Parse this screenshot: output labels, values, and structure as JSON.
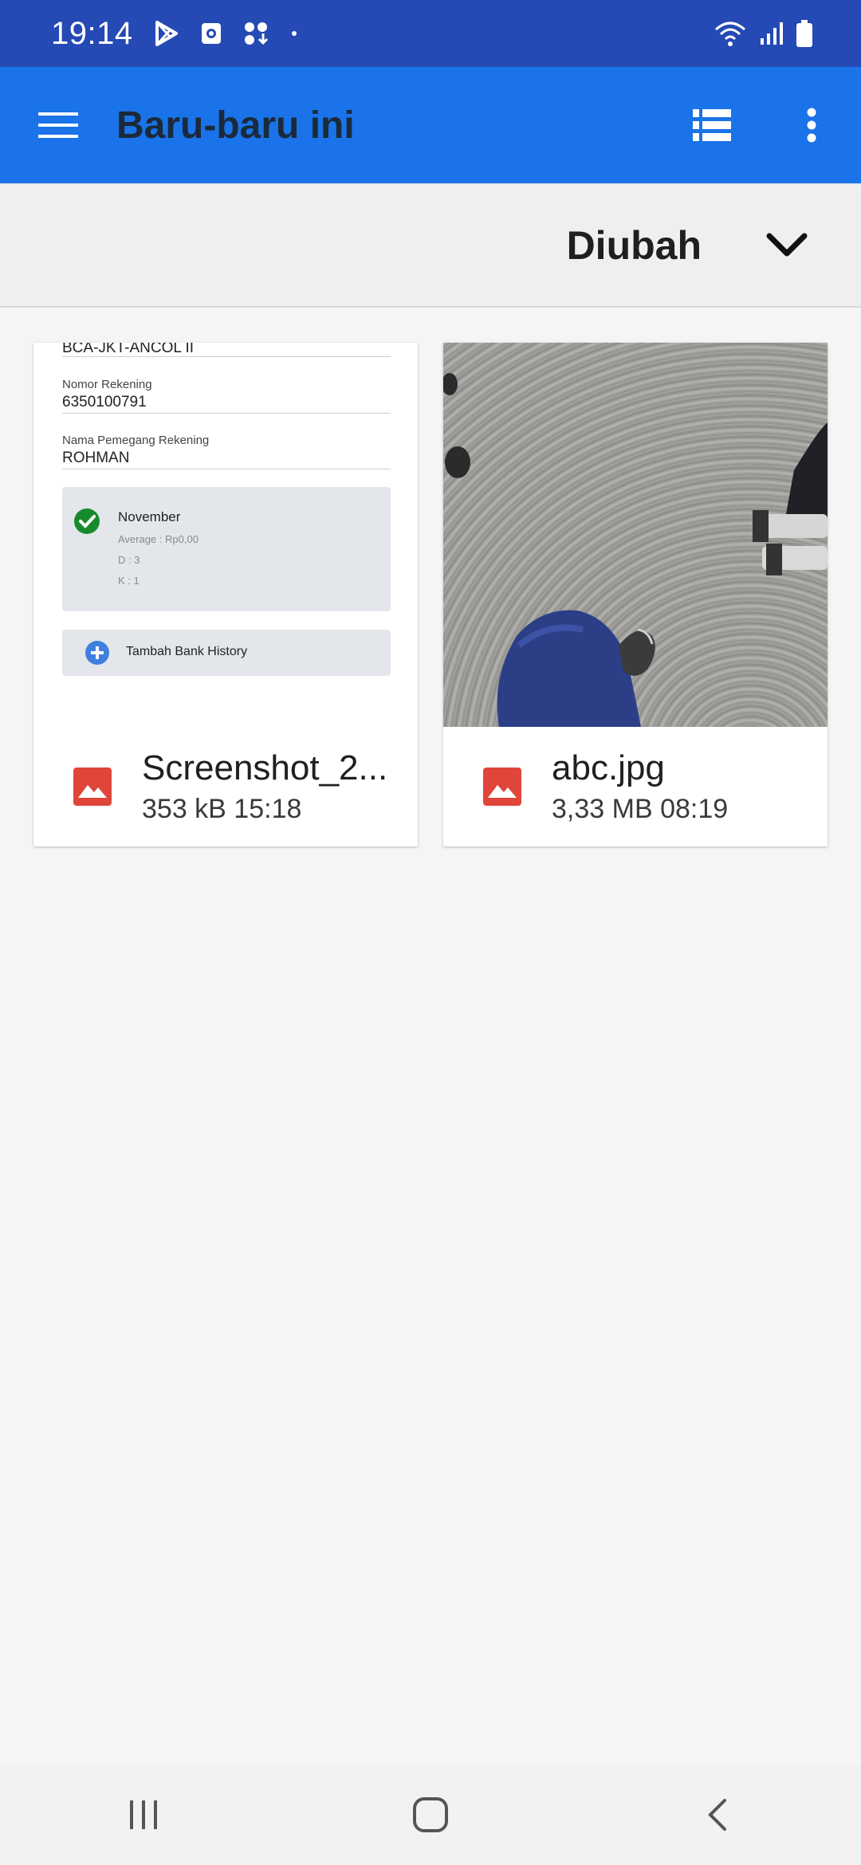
{
  "status_bar": {
    "time": "19:14",
    "left_icons": [
      "play-store-icon",
      "screen-record-icon",
      "download-icon",
      "dot-icon"
    ],
    "right_icons": [
      "wifi-icon",
      "signal-icon",
      "battery-icon"
    ]
  },
  "app_bar": {
    "title": "Baru-baru ini",
    "background": "#1a73e8",
    "icons": [
      "menu-icon",
      "list-view-icon",
      "more-vert-icon"
    ]
  },
  "sort": {
    "label": "Diubah",
    "icon": "chevron-down-icon"
  },
  "files": [
    {
      "name": "Screenshot_2...",
      "info": "353 kB 15:18",
      "type_icon": "image-file-icon",
      "icon_color": "#e0453a",
      "thumbnail": {
        "kind": "screenshot",
        "bank_branch": "BCA-JKT-ANCOL II",
        "account_number_label": "Nomor Rekening",
        "account_number": "6350100791",
        "holder_label": "Nama Pemegang Rekening",
        "holder_name": "ROHMAN",
        "month": "November",
        "average": "Average : Rp0,00",
        "debit": "D : 3",
        "credit": "K : 1",
        "add_button": "Tambah Bank History"
      }
    },
    {
      "name": "abc.jpg",
      "info": "3,33 MB 08:19",
      "type_icon": "image-file-icon",
      "icon_color": "#e0453a",
      "thumbnail": {
        "kind": "photo"
      }
    }
  ],
  "nav_bar": {
    "icons": [
      "recent-apps-icon",
      "home-icon",
      "back-icon"
    ]
  }
}
